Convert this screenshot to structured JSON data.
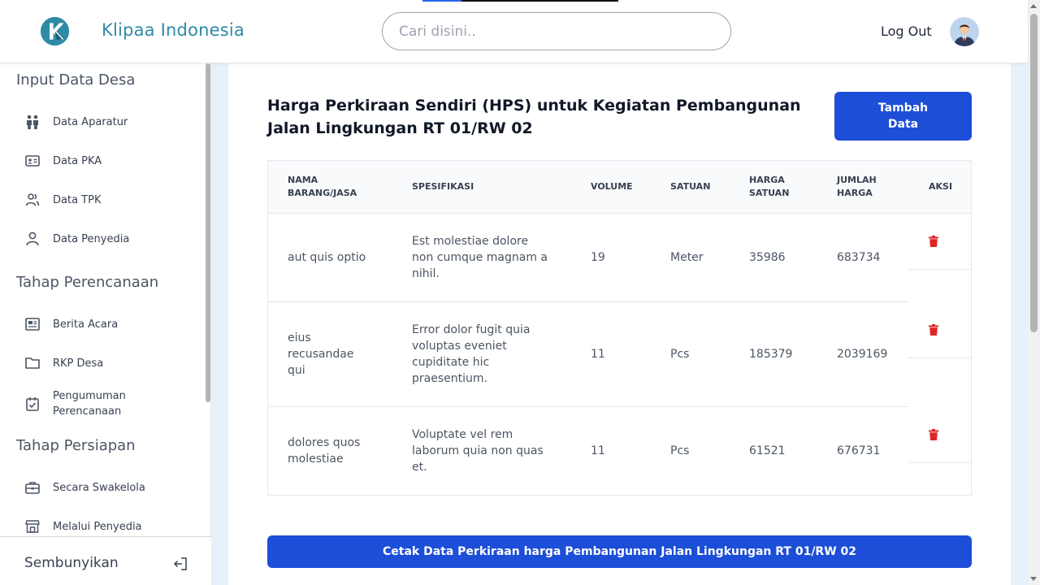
{
  "header": {
    "brand": "Klipaa Indonesia",
    "search_placeholder": "Cari disini..",
    "logout_label": "Log Out"
  },
  "sidebar": {
    "sections": [
      {
        "title": "Input Data Desa",
        "items": [
          {
            "label": "Data Aparatur",
            "icon": "people-icon"
          },
          {
            "label": "Data PKA",
            "icon": "id-card-icon"
          },
          {
            "label": "Data TPK",
            "icon": "users-icon"
          },
          {
            "label": "Data Penyedia",
            "icon": "user-icon"
          }
        ]
      },
      {
        "title": "Tahap Perencanaan",
        "items": [
          {
            "label": "Berita Acara",
            "icon": "newspaper-icon"
          },
          {
            "label": "RKP Desa",
            "icon": "folder-icon"
          },
          {
            "label": "Pengumuman Perencanaan",
            "icon": "calendar-check-icon"
          }
        ]
      },
      {
        "title": "Tahap Persiapan",
        "items": [
          {
            "label": "Secara Swakelola",
            "icon": "briefcase-icon"
          },
          {
            "label": "Melalui Penyedia",
            "icon": "store-icon"
          }
        ]
      }
    ],
    "footer_label": "Sembunyikan"
  },
  "main": {
    "title": "Harga Perkiraan Sendiri (HPS) untuk Kegiatan Pembangunan Jalan Lingkungan RT 01/RW 02",
    "add_button": "Tambah Data",
    "table": {
      "headers": [
        "NAMA BARANG/JASA",
        "SPESIFIKASI",
        "VOLUME",
        "SATUAN",
        "HARGA SATUAN",
        "JUMLAH HARGA",
        "AKSI"
      ],
      "rows": [
        {
          "nama": "aut quis optio",
          "spesifikasi": "Est molestiae dolore non cumque magnam a nihil.",
          "volume": "19",
          "satuan": "Meter",
          "harga_satuan": "35986",
          "jumlah_harga": "683734"
        },
        {
          "nama": "eius recusandae qui",
          "spesifikasi": "Error dolor fugit quia voluptas eveniet cupiditate hic praesentium.",
          "volume": "11",
          "satuan": "Pcs",
          "harga_satuan": "185379",
          "jumlah_harga": "2039169"
        },
        {
          "nama": "dolores quos molestiae",
          "spesifikasi": "Voluptate vel rem laborum quia non quas et.",
          "volume": "11",
          "satuan": "Pcs",
          "harga_satuan": "61521",
          "jumlah_harga": "676731"
        }
      ]
    },
    "print_button": "Cetak Data Perkiraan harga Pembangunan Jalan Lingkungan RT 01/RW 02"
  },
  "colors": {
    "primary": "#1d4ed8",
    "brand": "#2f8aa6",
    "delete": "#dc2626"
  }
}
